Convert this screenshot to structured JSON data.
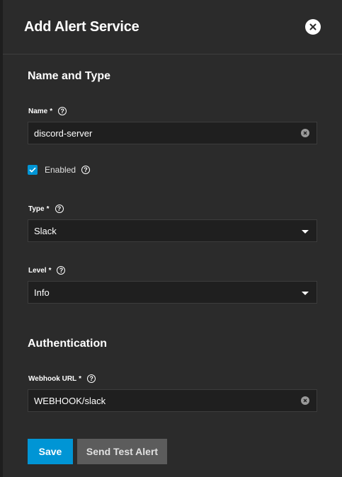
{
  "dialog": {
    "title": "Add Alert Service"
  },
  "sections": {
    "name_type": "Name and Type",
    "authentication": "Authentication"
  },
  "fields": {
    "name": {
      "label": "Name",
      "required_mark": "*",
      "value": "discord-server"
    },
    "enabled": {
      "label": "Enabled",
      "checked": true
    },
    "type": {
      "label": "Type",
      "required_mark": "*",
      "value": "Slack"
    },
    "level": {
      "label": "Level",
      "required_mark": "*",
      "value": "Info"
    },
    "webhook_url": {
      "label": "Webhook URL",
      "required_mark": "*",
      "value": "WEBHOOK/slack"
    }
  },
  "buttons": {
    "save": "Save",
    "send_test": "Send Test Alert"
  },
  "icons": {
    "help": "?",
    "close": "close-icon",
    "clear": "clear-icon",
    "check": "check-icon",
    "dropdown": "chevron-down-icon"
  },
  "colors": {
    "accent": "#0095d5",
    "panel_bg": "#2b2b2b",
    "input_bg": "#1f1f1f",
    "secondary_button": "#5c5c5c"
  }
}
